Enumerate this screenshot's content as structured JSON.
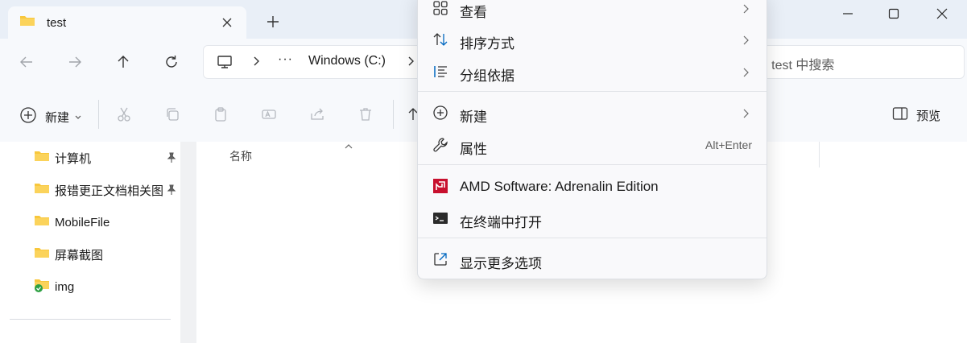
{
  "tab": {
    "title": "test"
  },
  "address": {
    "more": "···",
    "crumb": "Windows (C:)"
  },
  "search": {
    "placeholder_fragment": "E test 中搜索"
  },
  "toolbar": {
    "new_label": "新建",
    "preview_label": "预览"
  },
  "sidebar": {
    "items": [
      {
        "label": "计算机",
        "pinned": true
      },
      {
        "label": "报错更正文档相关图",
        "pinned": true
      },
      {
        "label": "MobileFile",
        "pinned": false
      },
      {
        "label": "屏幕截图",
        "pinned": false
      },
      {
        "label": "img",
        "pinned": false
      }
    ]
  },
  "main": {
    "column_name": "名称"
  },
  "context_menu": {
    "items": [
      {
        "label": "查看",
        "icon": "view-icon",
        "submenu": true
      },
      {
        "label": "排序方式",
        "icon": "sort-icon",
        "submenu": true
      },
      {
        "label": "分组依据",
        "icon": "group-icon",
        "submenu": true
      },
      {
        "label": "新建",
        "icon": "add-icon",
        "submenu": true
      },
      {
        "label": "属性",
        "icon": "wrench-icon",
        "shortcut": "Alt+Enter"
      },
      {
        "label": "AMD Software: Adrenalin Edition",
        "icon": "amd-icon"
      },
      {
        "label": "在终端中打开",
        "icon": "terminal-icon"
      },
      {
        "label": "显示更多选项",
        "icon": "more-options-icon"
      }
    ]
  },
  "colors": {
    "accent": "#0067c0",
    "folder": "#f8c73c",
    "amd": "#c8102e"
  }
}
